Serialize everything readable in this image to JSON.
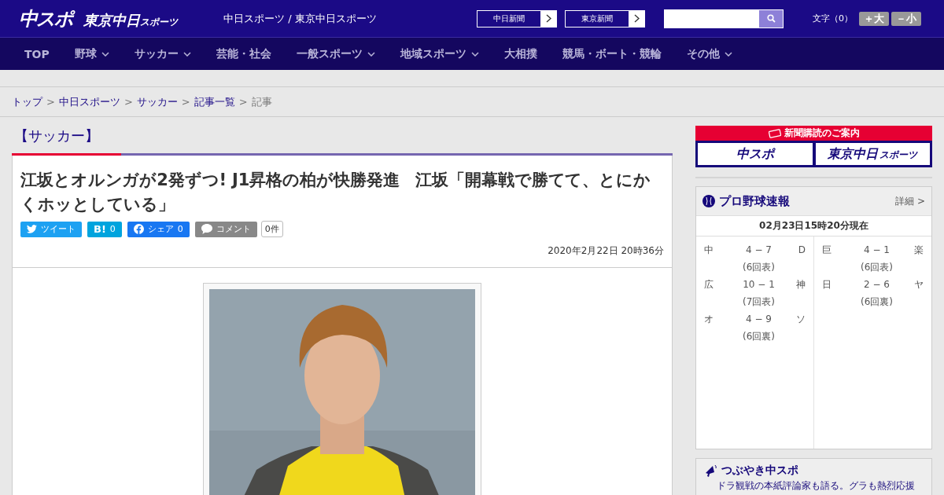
{
  "header": {
    "logo_main": "中スポ",
    "logo_sub": "東京中日",
    "logo_sub_small": "スポーツ",
    "site_name": "中日スポーツ / 東京中日スポーツ",
    "paper_links": [
      {
        "label": "中日新聞"
      },
      {
        "label": "東京新聞"
      }
    ],
    "font_size": {
      "label": "文字（0）",
      "buttons": [
        "＋大",
        "－小"
      ]
    }
  },
  "nav": [
    {
      "label": "TOP",
      "dropdown": false
    },
    {
      "label": "野球",
      "dropdown": true
    },
    {
      "label": "サッカー",
      "dropdown": true
    },
    {
      "label": "芸能・社会",
      "dropdown": false
    },
    {
      "label": "一般スポーツ",
      "dropdown": true
    },
    {
      "label": "地域スポーツ",
      "dropdown": true
    },
    {
      "label": "大相撲",
      "dropdown": false
    },
    {
      "label": "競馬・ボート・競輪",
      "dropdown": false
    },
    {
      "label": "その他",
      "dropdown": true
    }
  ],
  "breadcrumbs": [
    {
      "label": "トップ",
      "kind": "link"
    },
    {
      "label": ">",
      "kind": "sep"
    },
    {
      "label": "中日スポーツ",
      "kind": "link"
    },
    {
      "label": ">",
      "kind": "sep"
    },
    {
      "label": "サッカー",
      "kind": "link"
    },
    {
      "label": ">",
      "kind": "sep"
    },
    {
      "label": "記事一覧",
      "kind": "link"
    },
    {
      "label": ">",
      "kind": "sep"
    },
    {
      "label": "記事",
      "kind": "current"
    }
  ],
  "article": {
    "category": "【サッカー】",
    "title": "江坂とオルンガが2発ずつ! J1昇格の柏が快勝発進　江坂「開幕戦で勝てて、とにかくホッとしている」",
    "share": [
      {
        "kind": "twitter",
        "label": "ツイート"
      },
      {
        "kind": "hatena",
        "label": "B!",
        "count": "0"
      },
      {
        "kind": "facebook",
        "label": "シェア",
        "count": "0"
      },
      {
        "kind": "comment",
        "label": "コメント"
      }
    ],
    "comment_count": "0件",
    "date": "2020年2月22日 20時36分"
  },
  "sidebar": {
    "subscribe": {
      "heading": "新聞購読のご案内",
      "logos": [
        {
          "main": "中スポ"
        },
        {
          "main": "東京中日",
          "small": "スポーツ"
        }
      ]
    },
    "baseball": {
      "title": "プロ野球速報",
      "detail": "詳細 >",
      "updated": "02月23日15時20分現在",
      "columns": [
        [
          {
            "home": "中",
            "score": "4 − 7",
            "away": "D",
            "inning": "(6回表)"
          },
          {
            "home": "広",
            "score": "10 − 1",
            "away": "神",
            "inning": "(7回表)"
          },
          {
            "home": "オ",
            "score": "4 − 9",
            "away": "ソ",
            "inning": "(6回裏)"
          }
        ],
        [
          {
            "home": "巨",
            "score": "4 − 1",
            "away": "楽",
            "inning": "(6回表)"
          },
          {
            "home": "日",
            "score": "2 − 6",
            "away": "ヤ",
            "inning": "(6回裏)"
          }
        ]
      ]
    },
    "tsubuyaki": {
      "title": "つぶやき中スポ",
      "subtitle": "ドラ観戦の本紙評論家も語る。グラも熱烈応援"
    }
  }
}
